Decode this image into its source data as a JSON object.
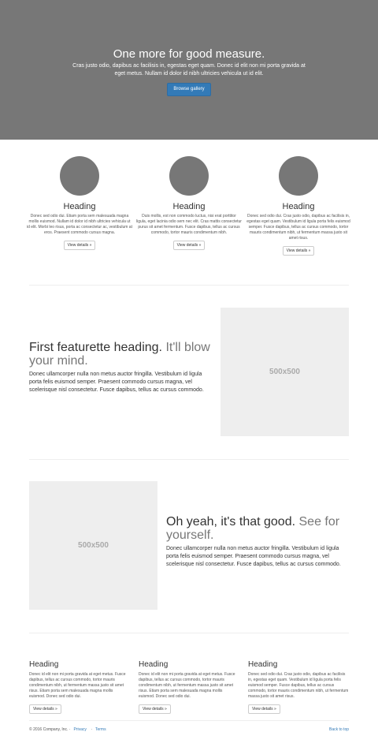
{
  "hero": {
    "title": "One more for good measure.",
    "text": "Cras justo odio, dapibus ac facilisis in, egestas eget quam. Donec id elit non mi porta gravida at eget metus. Nullam id dolor id nibh ultricies vehicula ut id elit.",
    "button": "Browse gallery"
  },
  "marketing": [
    {
      "heading": "Heading",
      "text": "Donec sed odio dui. Etiam porta sem malesuada magna mollis euismod. Nullam id dolor id nibh ultricies vehicula ut id elit. Morbi leo risus, porta ac consectetur ac, vestibulum at eros. Praesent commodo cursus magna.",
      "button": "View details »"
    },
    {
      "heading": "Heading",
      "text": "Duis mollis, est non commodo luctus, nisi erat porttitor ligula, eget lacinia odio sem nec elit. Cras mattis consectetur purus sit amet fermentum. Fusce dapibus, tellus ac cursus commodo, tortor mauris condimentum nibh.",
      "button": "View details »"
    },
    {
      "heading": "Heading",
      "text": "Donec sed odio dui. Cras justo odio, dapibus ac facilisis in, egestas eget quam. Vestibulum id ligula porta felis euismod semper. Fusce dapibus, tellus ac cursus commodo, tortor mauris condimentum nibh, ut fermentum massa justo sit amet risus.",
      "button": "View details »"
    }
  ],
  "featurette1": {
    "heading": "First featurette heading.",
    "muted": "It'll blow your mind.",
    "text": "Donec ullamcorper nulla non metus auctor fringilla. Vestibulum id ligula porta felis euismod semper. Praesent commodo cursus magna, vel scelerisque nisl consectetur. Fusce dapibus, tellus ac cursus commodo.",
    "image": "500x500"
  },
  "featurette2": {
    "heading": "Oh yeah, it's that good.",
    "muted": "See for yourself.",
    "text": "Donec ullamcorper nulla non metus auctor fringilla. Vestibulum id ligula porta felis euismod semper. Praesent commodo cursus magna, vel scelerisque nisl consectetur. Fusce dapibus, tellus ac cursus commodo.",
    "image": "500x500"
  },
  "bottom": [
    {
      "heading": "Heading",
      "text": "Donec id elit non mi porta gravida at eget metus. Fusce dapibus, tellus ac cursus commodo, tortor mauris condimentum nibh, ut fermentum massa justo sit amet risus. Etiam porta sem malesuada magna mollis euismod. Donec sed odio dui.",
      "button": "View details »"
    },
    {
      "heading": "Heading",
      "text": "Donec id elit non mi porta gravida at eget metus. Fusce dapibus, tellus ac cursus commodo, tortor mauris condimentum nibh, ut fermentum massa justo sit amet risus. Etiam porta sem malesuada magna mollis euismod. Donec sed odio dui.",
      "button": "View details »"
    },
    {
      "heading": "Heading",
      "text": "Donec sed odio dui. Cras justo odio, dapibus ac facilisis in, egestas eget quam. Vestibulum id ligula porta felis euismod semper. Fusce dapibus, tellus ac cursus commodo, tortor mauris condimentum nibh, ut fermentum massa justo sit amet risus.",
      "button": "View details »"
    }
  ],
  "footer": {
    "copyright": "© 2016 Company, Inc.",
    "privacy": "Privacy",
    "terms": "Terms",
    "back_to_top": "Back to top"
  }
}
